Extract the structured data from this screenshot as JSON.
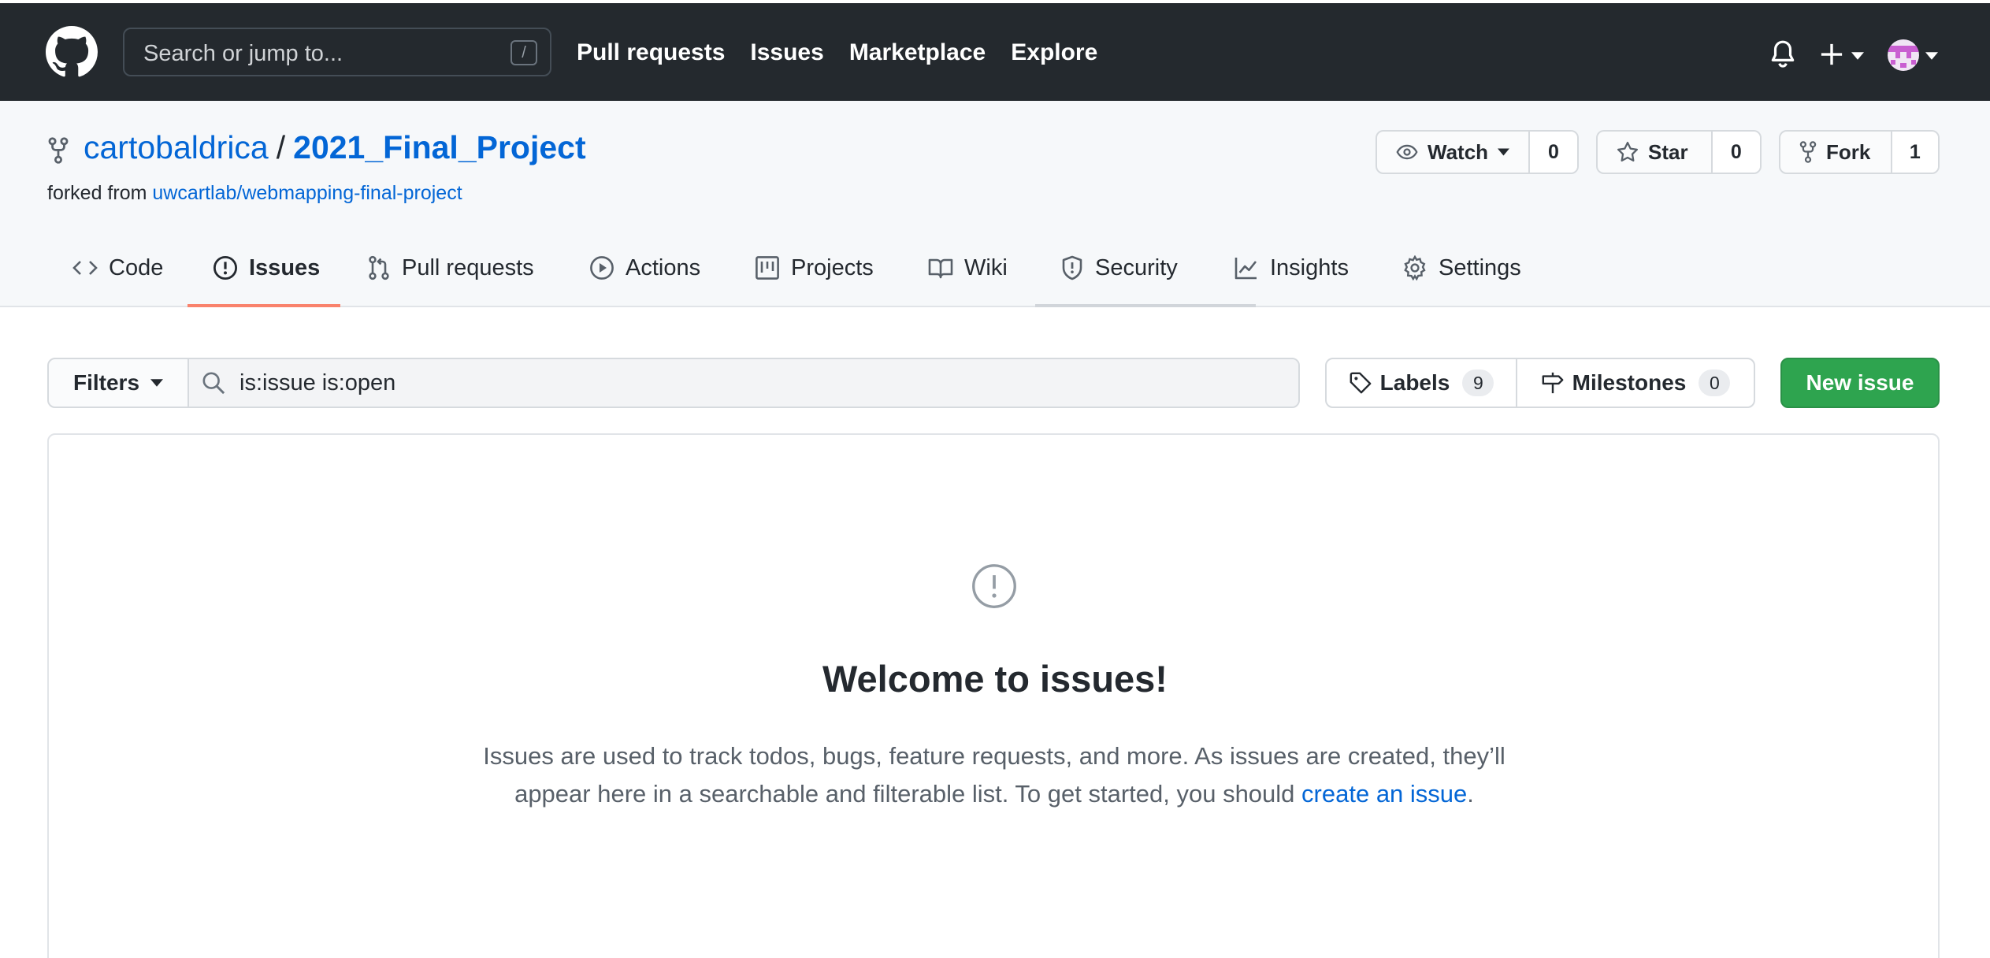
{
  "header": {
    "search_placeholder": "Search or jump to...",
    "search_shortcut": "/",
    "nav": [
      "Pull requests",
      "Issues",
      "Marketplace",
      "Explore"
    ]
  },
  "repo": {
    "owner": "cartobaldrica",
    "separator": "/",
    "name": "2021_Final_Project",
    "forked_prefix": "forked from",
    "forked_source": "uwcartlab/webmapping-final-project"
  },
  "social": {
    "watch_label": "Watch",
    "watch_count": "0",
    "star_label": "Star",
    "star_count": "0",
    "fork_label": "Fork",
    "fork_count": "1"
  },
  "tabs": [
    {
      "label": "Code",
      "icon": "code-icon"
    },
    {
      "label": "Issues",
      "icon": "issue-opened-icon",
      "selected": true
    },
    {
      "label": "Pull requests",
      "icon": "git-pull-request-icon"
    },
    {
      "label": "Actions",
      "icon": "play-icon"
    },
    {
      "label": "Projects",
      "icon": "project-icon"
    },
    {
      "label": "Wiki",
      "icon": "book-icon"
    },
    {
      "label": "Security",
      "icon": "shield-icon"
    },
    {
      "label": "Insights",
      "icon": "graph-icon"
    },
    {
      "label": "Settings",
      "icon": "gear-icon"
    }
  ],
  "toolbar": {
    "filters_label": "Filters",
    "filter_value": "is:issue is:open",
    "labels_label": "Labels",
    "labels_count": "9",
    "milestones_label": "Milestones",
    "milestones_count": "0",
    "new_issue_label": "New issue"
  },
  "blankslate": {
    "title": "Welcome to issues!",
    "text": "Issues are used to track todos, bugs, feature requests, and more. As issues are created, they’ll appear here in a searchable and filterable list. To get started, you should",
    "link_text": "create an issue",
    "end": "."
  },
  "colors": {
    "header_bg": "#24292e",
    "link": "#0366d6",
    "active_tab_underline": "#f9826c",
    "primary_button": "#2ea44f"
  }
}
